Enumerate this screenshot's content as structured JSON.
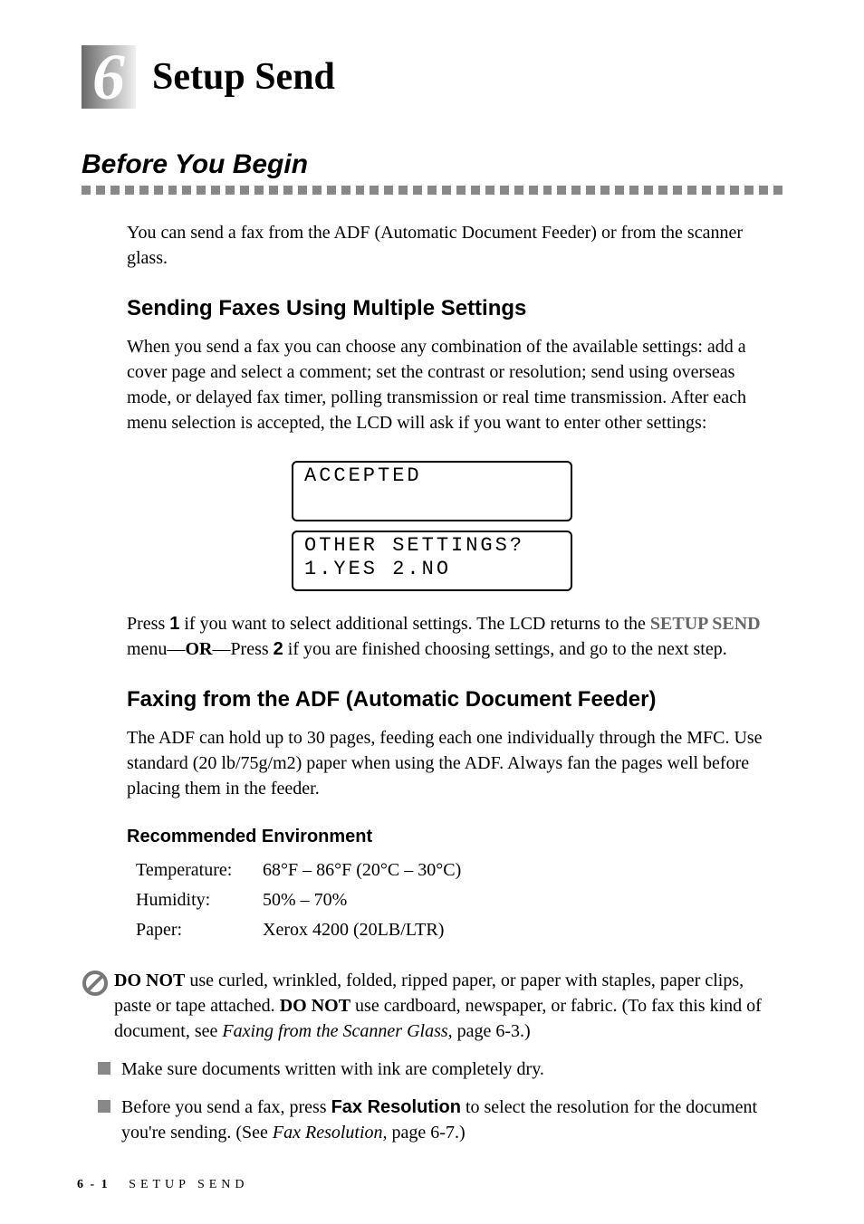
{
  "chapter": {
    "number": "6",
    "title": "Setup Send"
  },
  "section": {
    "title": "Before You Begin",
    "intro": "You can send a fax from the ADF (Automatic Document Feeder) or from the scanner glass."
  },
  "subsection1": {
    "title": "Sending Faxes Using Multiple Settings",
    "text": "When you send a fax you can choose any combination of the available settings: add a cover page and select a comment; set the contrast or resolution; send using overseas mode, or delayed fax timer, polling transmission or real time transmission. After each menu selection is accepted, the LCD will ask if you want to enter other settings:",
    "lcd1": "ACCEPTED",
    "lcd2_line1": "OTHER SETTINGS?",
    "lcd2_line2": "1.YES 2.NO",
    "after_press": "Press ",
    "key1": "1",
    "after_key1": " if you want to select additional settings. The LCD returns to the ",
    "menu": "SETUP SEND",
    "after_menu": " menu—",
    "or": "OR",
    "after_or": "—Press ",
    "key2": "2",
    "after_key2": " if you are finished choosing settings, and go to the next step."
  },
  "subsection2": {
    "title": "Faxing from the ADF (Automatic Document Feeder)",
    "text": "The ADF can hold up to 30 pages, feeding each one individually through the MFC. Use standard (20 lb/75g/m2) paper when using the ADF. Always fan the pages well before placing them in the feeder."
  },
  "environment": {
    "title": "Recommended Environment",
    "temp_label": "Temperature:",
    "temp_value": "68°F – 86°F (20°C – 30°C)",
    "humidity_label": "Humidity:",
    "humidity_value": "50% – 70%",
    "paper_label": "Paper:",
    "paper_value": "Xerox 4200 (20LB/LTR)"
  },
  "warning": {
    "donot1": "DO NOT",
    "text1": " use curled, wrinkled, folded, ripped paper, or paper with staples, paper clips, paste or tape attached. ",
    "donot2": "DO NOT",
    "text2": " use cardboard, newspaper, or fabric. (To fax this kind of document, see ",
    "ref": "Faxing from the Scanner Glass",
    "text3": ", page 6-3.)"
  },
  "bullets": {
    "b1": "Make sure documents written with ink are completely dry.",
    "b2_pre": "Before you send a fax, press ",
    "b2_key": "Fax Resolution",
    "b2_mid": " to select the resolution for the document you're sending. (See ",
    "b2_ref": "Fax Resolution",
    "b2_end": ", page 6-7.)"
  },
  "footer": {
    "page": "6 - 1",
    "section": "SETUP SEND"
  }
}
